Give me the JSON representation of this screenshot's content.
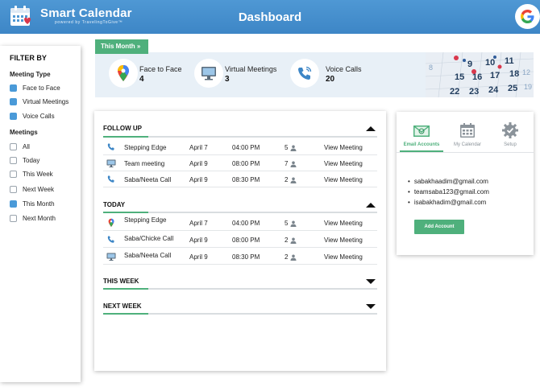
{
  "header": {
    "brand": "Smart Calendar",
    "brand_sub": "powered by TravelingToGive™",
    "title": "Dashboard",
    "account_icon": "google-g-icon"
  },
  "sidebar": {
    "title": "FILTER BY",
    "meeting_type": {
      "heading": "Meeting Type",
      "items": [
        {
          "label": "Face to Face",
          "checked": true
        },
        {
          "label": "Virtual Meetings",
          "checked": true
        },
        {
          "label": "Voice Calls",
          "checked": true
        }
      ]
    },
    "meetings": {
      "heading": "Meetings",
      "items": [
        {
          "label": "All",
          "checked": false
        },
        {
          "label": "Today",
          "checked": false
        },
        {
          "label": "This Week",
          "checked": false
        },
        {
          "label": "Next Week",
          "checked": false
        },
        {
          "label": "This Month",
          "checked": true
        },
        {
          "label": "Next Month",
          "checked": false
        }
      ]
    }
  },
  "stats": {
    "period_label": "This Month »",
    "items": [
      {
        "label": "Face to Face",
        "value": "4",
        "icon": "map-pin-icon"
      },
      {
        "label": "Virtual Meetings",
        "value": "3",
        "icon": "monitor-icon"
      },
      {
        "label": "Voice Calls",
        "value": "20",
        "icon": "phone-icon"
      }
    ]
  },
  "sections": [
    {
      "title": "FOLLOW UP",
      "expanded": true,
      "rows": [
        {
          "icon": "phone",
          "name": "Stepping Edge",
          "date": "April 7",
          "time": "04:00 PM",
          "count": "5",
          "action": "View Meeting"
        },
        {
          "icon": "monitor",
          "name": "Team meeting",
          "date": "April 9",
          "time": "08:00 PM",
          "count": "7",
          "action": "View Meeting"
        },
        {
          "icon": "phone",
          "name": "Saba/Neeta Call",
          "date": "April 9",
          "time": "08:30 PM",
          "count": "2",
          "action": "View Meeting"
        }
      ]
    },
    {
      "title": "TODAY",
      "expanded": true,
      "rows": [
        {
          "icon": "pin",
          "name": "Stepping Edge",
          "date": "April 7",
          "time": "04:00 PM",
          "count": "5",
          "action": "View Meeting"
        },
        {
          "icon": "phone",
          "name": "Saba/Chicke Call",
          "date": "April 9",
          "time": "08:00 PM",
          "count": "2",
          "action": "View Meeting"
        },
        {
          "icon": "monitor",
          "name": "Saba/Neeta Call",
          "date": "April 9",
          "time": "08:30 PM",
          "count": "2",
          "action": "View Meeting"
        }
      ]
    },
    {
      "title": "THIS WEEK",
      "expanded": false,
      "rows": []
    },
    {
      "title": "NEXT WEEK",
      "expanded": false,
      "rows": []
    }
  ],
  "accounts": {
    "tabs": [
      {
        "label": "Email Accounts",
        "icon": "email-accounts-icon",
        "active": true
      },
      {
        "label": "My Calendar",
        "icon": "calendar-icon",
        "active": false
      },
      {
        "label": "Setup",
        "icon": "settings-gear-icon",
        "active": false
      }
    ],
    "emails": [
      "sabakhaadim@gmail.com",
      "teamsaba123@gmail.com",
      "isabakhadim@gmail.com"
    ],
    "add_label": "Add Account"
  },
  "colors": {
    "header": "#4f98d4",
    "accent_green": "#4fb07c",
    "checkbox_blue": "#4a9ad8",
    "stats_bg": "#e8f0f7"
  }
}
